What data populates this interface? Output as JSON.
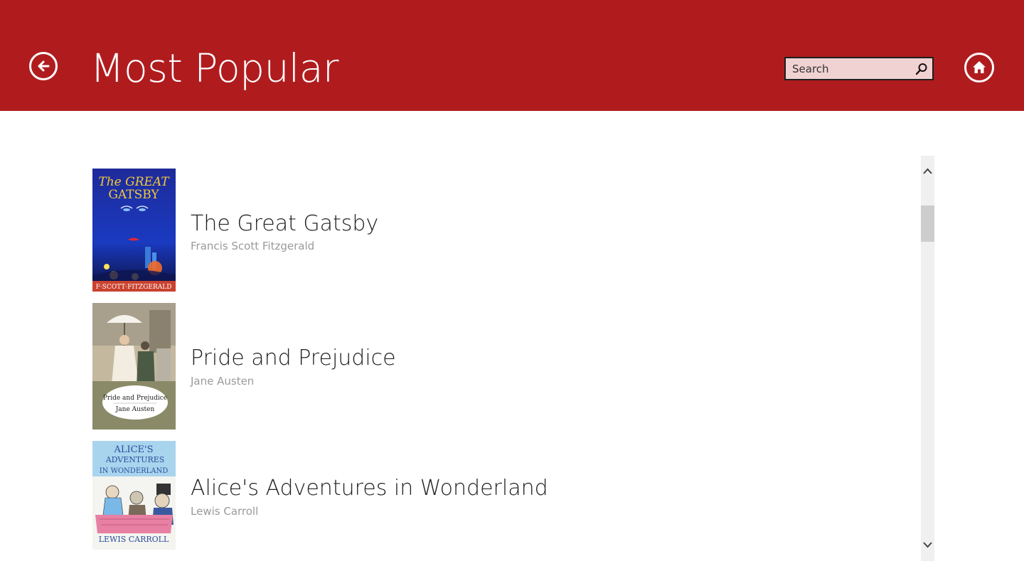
{
  "header": {
    "title": "Most Popular",
    "background_color": "#b01c1e",
    "back_icon": "back-arrow-icon",
    "home_icon": "home-icon"
  },
  "search": {
    "placeholder": "Search",
    "value": "",
    "icon": "search-icon"
  },
  "books": [
    {
      "title": "The Great Gatsby",
      "author": "Francis Scott Fitzgerald",
      "cover_text": "The GREAT GATSBY",
      "cover_author": "F·SCOTT·FITZGERALD"
    },
    {
      "title": "Pride and Prejudice",
      "author": "Jane Austen",
      "cover_text": "Pride and Prejudice",
      "cover_author": "Jane Austen"
    },
    {
      "title": "Alice's Adventures in Wonderland",
      "author": "Lewis Carroll",
      "cover_text": "ALICE'S ADVENTURES IN WONDERLAND",
      "cover_author": "LEWIS CARROLL"
    }
  ]
}
